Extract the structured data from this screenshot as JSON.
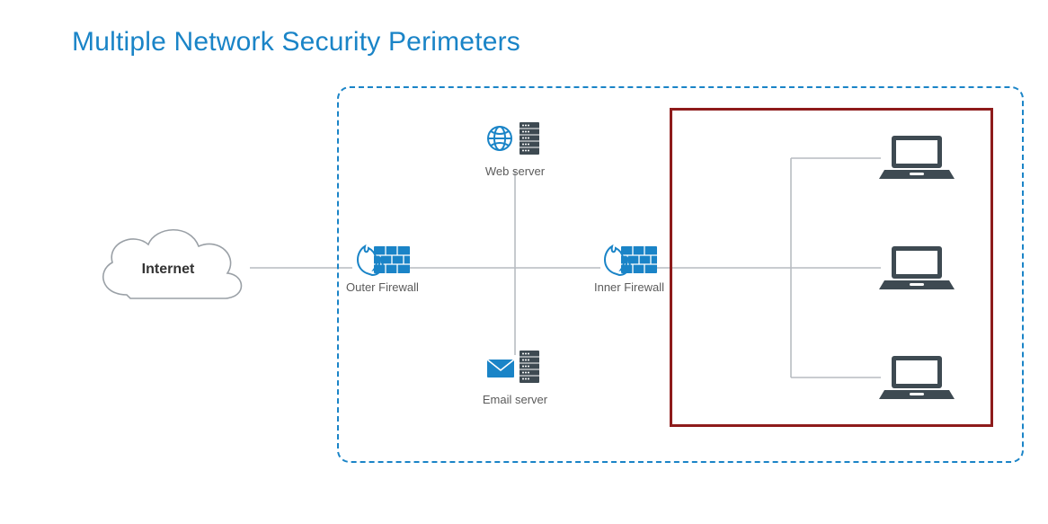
{
  "title": "Multiple Network Security Perimeters",
  "nodes": {
    "internet": "Internet",
    "outer_firewall": "Outer Firewall",
    "inner_firewall": "Inner Firewall",
    "web_server": "Web server",
    "email_server": "Email server"
  },
  "colors": {
    "accent": "#1a84c7",
    "dark": "#3e4a52",
    "outline": "#9aa0a6",
    "red": "#8e1b1b"
  },
  "edges_description": "Internet → Outer Firewall → (Web server, Email server, Inner Firewall). Inner Firewall → three internal laptops inside red perimeter. Blue dashed rounded rectangle encloses DMZ + internal zone; solid red rectangle encloses internal laptops.",
  "laptop_count": 3
}
